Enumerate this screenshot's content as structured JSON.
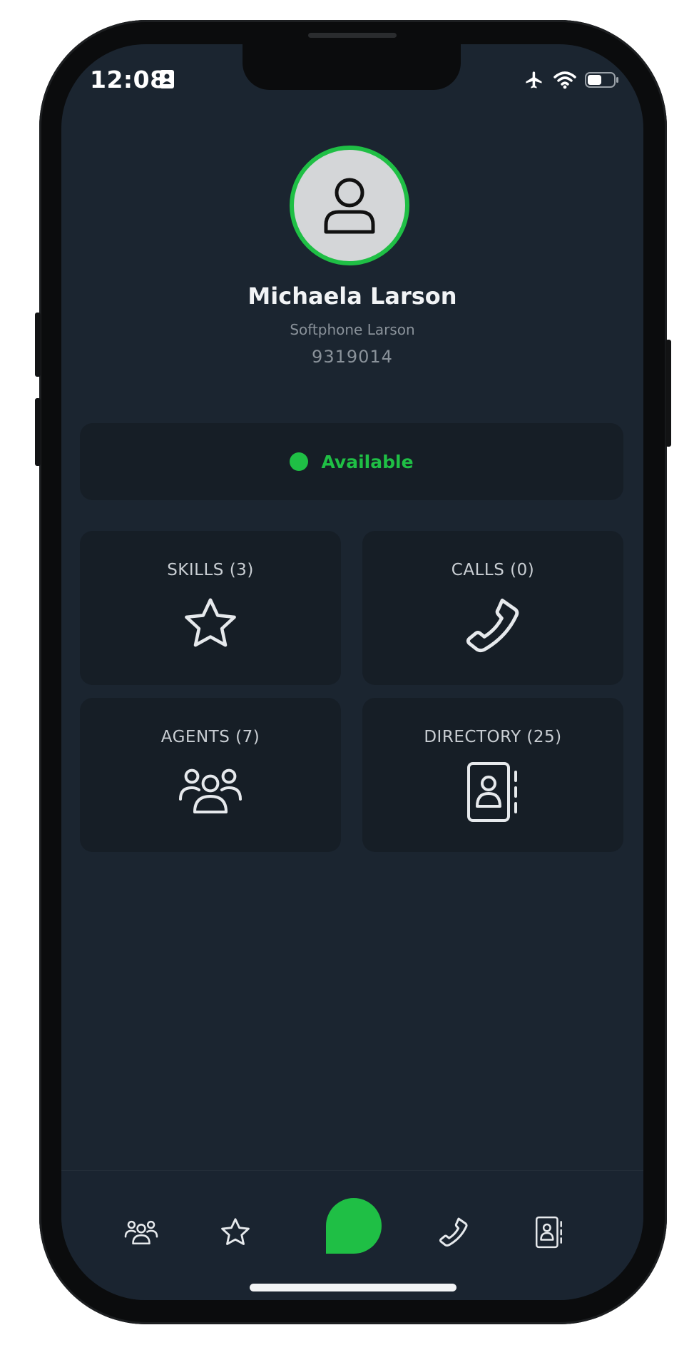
{
  "status_bar": {
    "time": "12:08",
    "left_icon": "contact-card-icon",
    "right_icons": [
      "airplane-icon",
      "wifi-icon",
      "battery-icon"
    ]
  },
  "profile": {
    "name": "Michaela Larson",
    "device": "Softphone Larson",
    "extension": "9319014",
    "avatar_icon": "user-icon"
  },
  "availability": {
    "label": "Available",
    "color": "#1fbf45"
  },
  "tiles": [
    {
      "label": "SKILLS (3)",
      "icon": "star-icon"
    },
    {
      "label": "CALLS (0)",
      "icon": "phone-icon"
    },
    {
      "label": "AGENTS (7)",
      "icon": "group-icon"
    },
    {
      "label": "DIRECTORY (25)",
      "icon": "contact-book-icon"
    }
  ],
  "bottom_nav": {
    "items": [
      "group-icon",
      "star-icon",
      "chat-bubble-icon",
      "phone-icon",
      "contact-book-icon"
    ]
  },
  "colors": {
    "background": "#1b2530",
    "card": "#161e26",
    "accent": "#1fbf45"
  }
}
